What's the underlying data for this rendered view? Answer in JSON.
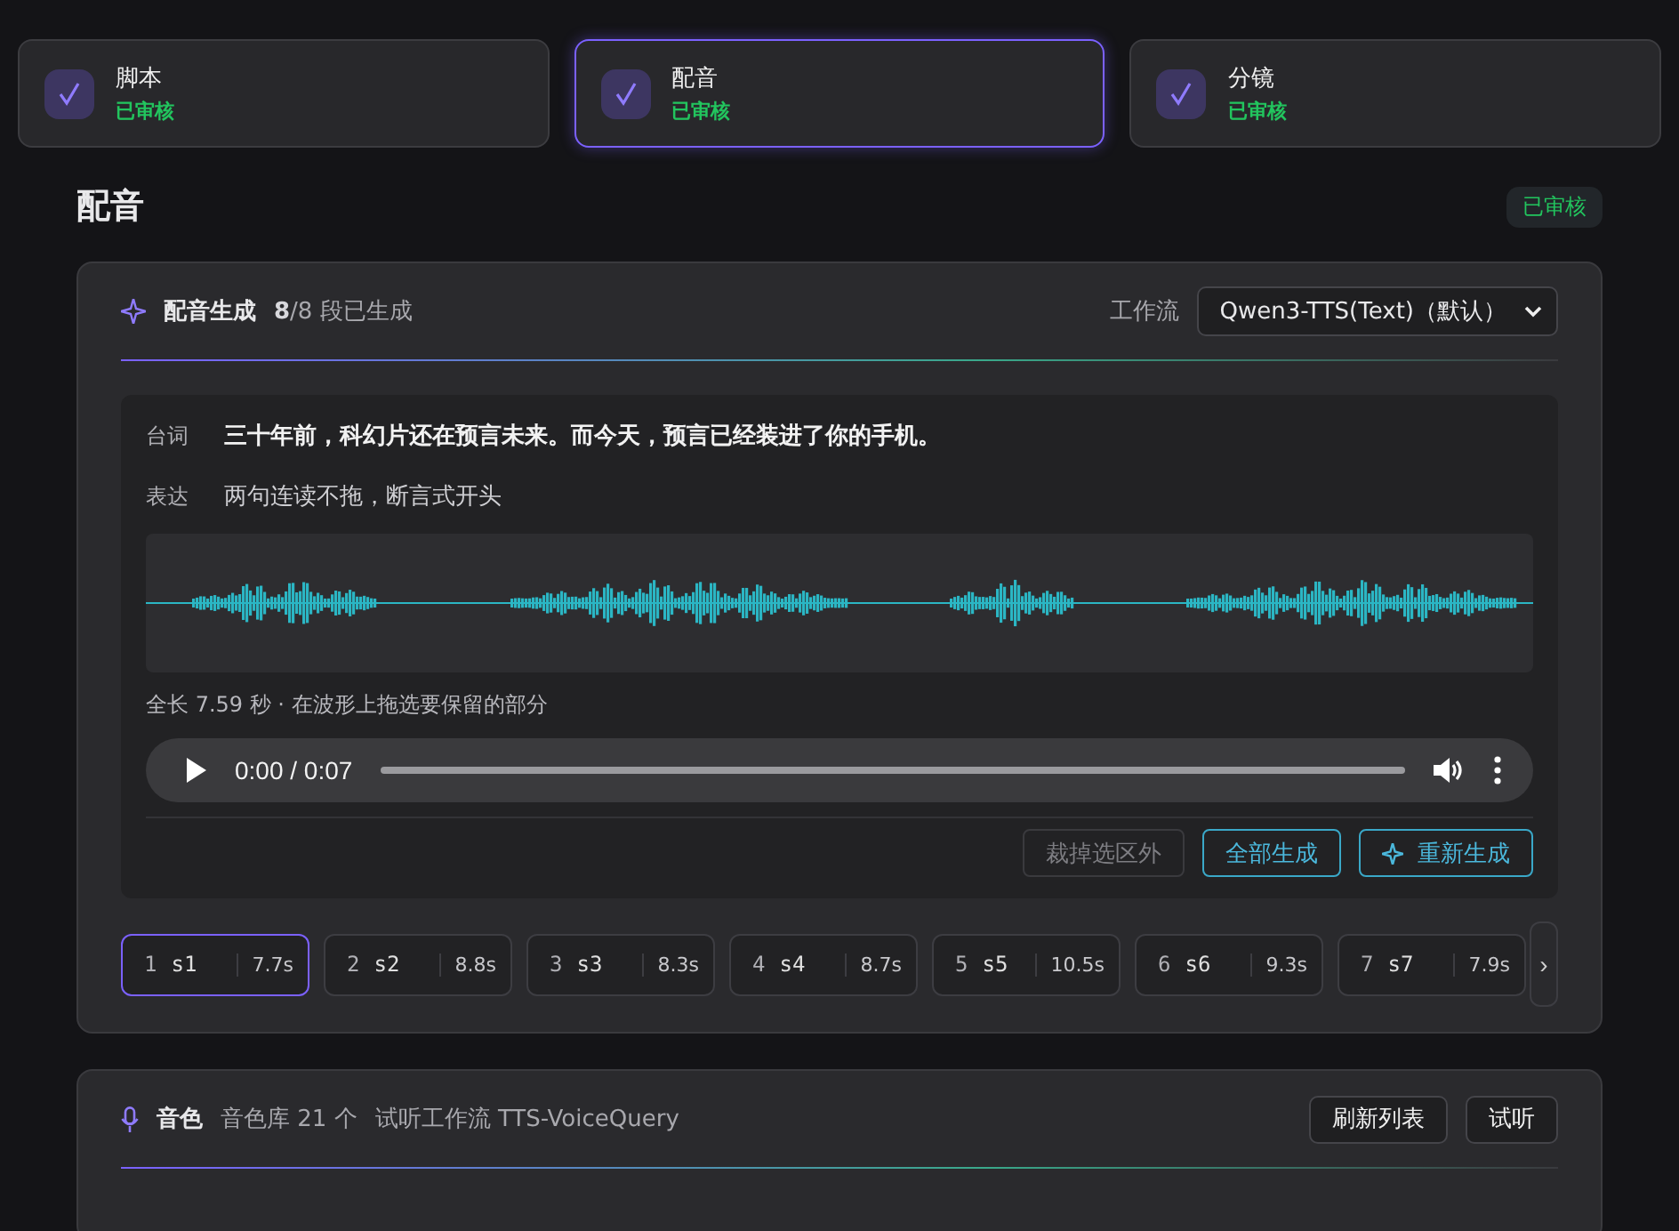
{
  "steps": [
    {
      "title": "脚本",
      "status": "已审核",
      "selected": false
    },
    {
      "title": "配音",
      "status": "已审核",
      "selected": true
    },
    {
      "title": "分镜",
      "status": "已审核",
      "selected": false
    }
  ],
  "page": {
    "title": "配音",
    "badge": "已审核"
  },
  "generation": {
    "title": "配音生成",
    "count_done": "8",
    "count_rest": "/8 段已生成",
    "workflow_label": "工作流",
    "workflow_value": "Qwen3-TTS(Text)（默认）",
    "line_label": "台词",
    "line_text": "三十年前，科幻片还在预言未来。而今天，预言已经装进了你的手机。",
    "expr_label": "表达",
    "expr_text": "两句连读不拖，断言式开头",
    "hint": "全长 7.59 秒 · 在波形上拖选要保留的部分",
    "player": {
      "time": "0:00 / 0:07"
    },
    "buttons": [
      {
        "label": "裁掉选区外",
        "kind": "disabled"
      },
      {
        "label": "全部生成",
        "kind": "outline"
      },
      {
        "label": "重新生成",
        "kind": "sparkle"
      }
    ],
    "segments": [
      {
        "index": "1",
        "name": "s1",
        "duration": "7.7s",
        "selected": true
      },
      {
        "index": "2",
        "name": "s2",
        "duration": "8.8s",
        "selected": false
      },
      {
        "index": "3",
        "name": "s3",
        "duration": "8.3s",
        "selected": false
      },
      {
        "index": "4",
        "name": "s4",
        "duration": "8.7s",
        "selected": false
      },
      {
        "index": "5",
        "name": "s5",
        "duration": "10.5s",
        "selected": false
      },
      {
        "index": "6",
        "name": "s6",
        "duration": "9.3s",
        "selected": false
      },
      {
        "index": "7",
        "name": "s7",
        "duration": "7.9s",
        "selected": false
      }
    ],
    "next": "›"
  },
  "voice": {
    "title": "音色",
    "library": "音色库 21 个",
    "workflow": "试听工作流 TTS-VoiceQuery",
    "buttons": [
      "刷新列表",
      "试听"
    ]
  }
}
